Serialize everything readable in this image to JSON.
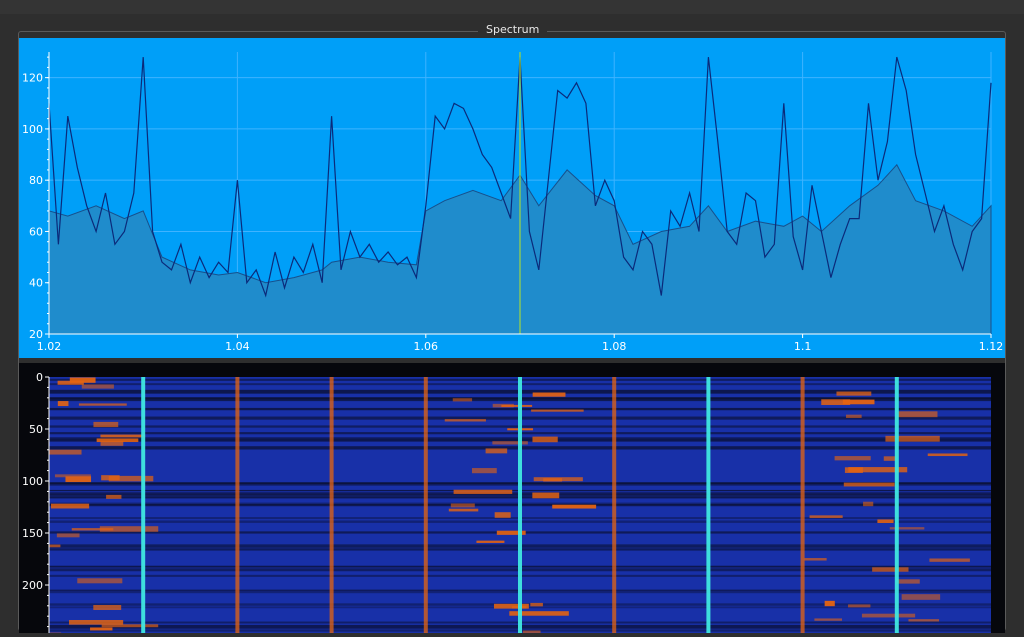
{
  "window": {
    "group_title": "Spectrum"
  },
  "colors": {
    "spectrum_bg": "#009ff8",
    "plot_fill": "#1f8ccc",
    "trace": "#0b2a7a",
    "marker": "#9fd640",
    "waterfall_bg": "#07080c",
    "waterfall_low": "#1830a8",
    "waterfall_high": "#e66410",
    "waterfall_peak": "#40e8e0"
  },
  "chart_data": [
    {
      "type": "area",
      "title": "",
      "xlim": [
        1.02,
        1.12
      ],
      "ylim": [
        20,
        130
      ],
      "x_ticks": [
        1.02,
        1.04,
        1.06,
        1.08,
        1.1,
        1.12
      ],
      "x_tick_labels": [
        "1.02",
        "1.04",
        "1.06",
        "1.08",
        "1.1",
        "1.12"
      ],
      "y_ticks": [
        20,
        40,
        60,
        80,
        100,
        120
      ],
      "y_tick_labels": [
        "20",
        "40",
        "60",
        "80",
        "100",
        "120"
      ],
      "grid": true,
      "marker_x": 1.07,
      "series": [
        {
          "style": "area",
          "x": [
            1.02,
            1.022,
            1.025,
            1.028,
            1.03,
            1.032,
            1.035,
            1.038,
            1.04,
            1.043,
            1.046,
            1.049,
            1.05,
            1.053,
            1.056,
            1.059,
            1.06,
            1.062,
            1.065,
            1.068,
            1.07,
            1.072,
            1.075,
            1.078,
            1.08,
            1.082,
            1.085,
            1.088,
            1.09,
            1.092,
            1.095,
            1.098,
            1.1,
            1.102,
            1.105,
            1.108,
            1.11,
            1.112,
            1.115,
            1.118,
            1.12
          ],
          "y": [
            68,
            66,
            70,
            65,
            68,
            50,
            45,
            43,
            44,
            40,
            42,
            45,
            48,
            50,
            48,
            47,
            68,
            72,
            76,
            72,
            82,
            70,
            84,
            74,
            70,
            55,
            60,
            62,
            70,
            60,
            64,
            62,
            66,
            60,
            70,
            78,
            86,
            72,
            68,
            62,
            70
          ]
        },
        {
          "style": "line",
          "x": [
            1.02,
            1.021,
            1.022,
            1.023,
            1.024,
            1.025,
            1.026,
            1.027,
            1.028,
            1.029,
            1.03,
            1.031,
            1.032,
            1.033,
            1.034,
            1.035,
            1.036,
            1.037,
            1.038,
            1.039,
            1.04,
            1.041,
            1.042,
            1.043,
            1.044,
            1.045,
            1.046,
            1.047,
            1.048,
            1.049,
            1.05,
            1.051,
            1.052,
            1.053,
            1.054,
            1.055,
            1.056,
            1.057,
            1.058,
            1.059,
            1.06,
            1.061,
            1.062,
            1.063,
            1.064,
            1.065,
            1.066,
            1.067,
            1.068,
            1.069,
            1.07,
            1.071,
            1.072,
            1.073,
            1.074,
            1.075,
            1.076,
            1.077,
            1.078,
            1.079,
            1.08,
            1.081,
            1.082,
            1.083,
            1.084,
            1.085,
            1.086,
            1.087,
            1.088,
            1.089,
            1.09,
            1.091,
            1.092,
            1.093,
            1.094,
            1.095,
            1.096,
            1.097,
            1.098,
            1.099,
            1.1,
            1.101,
            1.102,
            1.103,
            1.104,
            1.105,
            1.106,
            1.107,
            1.108,
            1.109,
            1.11,
            1.111,
            1.112,
            1.113,
            1.114,
            1.115,
            1.116,
            1.117,
            1.118,
            1.119,
            1.12
          ],
          "y": [
            110,
            55,
            105,
            85,
            70,
            60,
            75,
            55,
            60,
            75,
            128,
            60,
            48,
            45,
            55,
            40,
            50,
            42,
            48,
            44,
            80,
            40,
            45,
            35,
            52,
            38,
            50,
            44,
            55,
            40,
            105,
            45,
            60,
            50,
            55,
            48,
            52,
            47,
            50,
            42,
            70,
            105,
            100,
            110,
            108,
            100,
            90,
            85,
            75,
            65,
            128,
            60,
            45,
            80,
            115,
            112,
            118,
            110,
            70,
            80,
            72,
            50,
            45,
            60,
            55,
            35,
            68,
            62,
            75,
            60,
            128,
            95,
            60,
            55,
            75,
            72,
            50,
            55,
            110,
            58,
            45,
            78,
            60,
            42,
            55,
            65,
            65,
            110,
            80,
            95,
            128,
            115,
            90,
            75,
            60,
            70,
            55,
            45,
            60,
            65,
            118
          ]
        }
      ]
    },
    {
      "type": "heatmap",
      "title": "",
      "y_ticks": [
        0,
        50,
        100,
        150,
        200
      ],
      "y_tick_labels": [
        "0",
        "50",
        "100",
        "150",
        "200"
      ],
      "x_range": [
        1.02,
        1.12
      ],
      "peak_lines_x": [
        1.03,
        1.04,
        1.05,
        1.06,
        1.07,
        1.08,
        1.09,
        1.1,
        1.11
      ]
    }
  ]
}
